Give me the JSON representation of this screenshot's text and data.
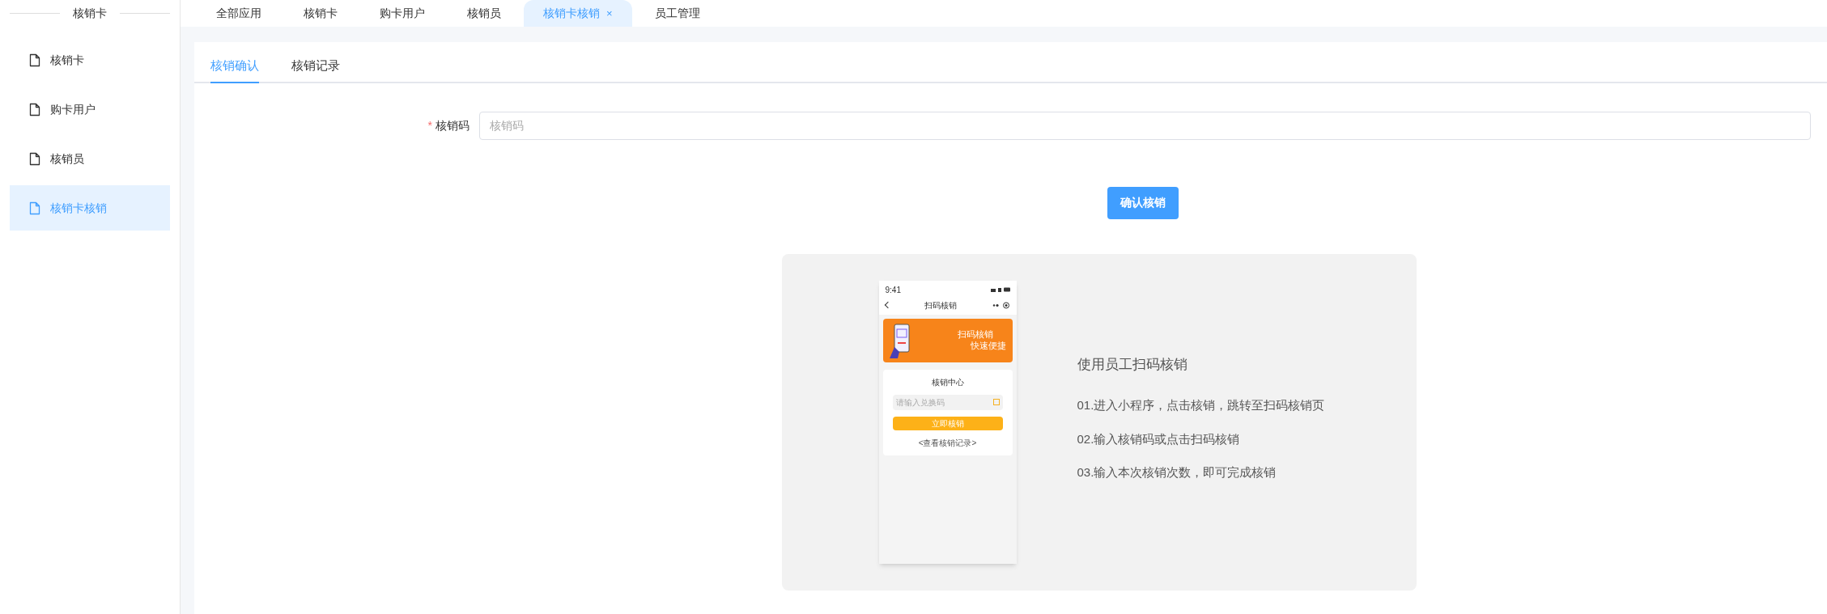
{
  "sidebar": {
    "title": "核销卡",
    "items": [
      {
        "label": "核销卡",
        "selected": false
      },
      {
        "label": "购卡用户",
        "selected": false
      },
      {
        "label": "核销员",
        "selected": false
      },
      {
        "label": "核销卡核销",
        "selected": true
      }
    ]
  },
  "top_tabs": [
    {
      "label": "全部应用",
      "selected": false
    },
    {
      "label": "核销卡",
      "selected": false
    },
    {
      "label": "购卡用户",
      "selected": false
    },
    {
      "label": "核销员",
      "selected": false
    },
    {
      "label": "核销卡核销",
      "selected": true,
      "close_mark": "×"
    },
    {
      "label": "员工管理",
      "selected": false
    }
  ],
  "content_tabs": [
    {
      "label": "核销确认",
      "selected": true
    },
    {
      "label": "核销记录",
      "selected": false
    }
  ],
  "form": {
    "label": "核销码",
    "required_mark": "*",
    "placeholder": "核销码",
    "submit": "确认核销"
  },
  "guide": {
    "phone": {
      "time": "9:41",
      "title": "扫码核销",
      "banner_lines": [
        "扫码核销",
        "快速便捷"
      ],
      "card_title": "核销中心",
      "placeholder": "请输入兑换码",
      "button": "立即核销",
      "link": "<查看核销记录>"
    },
    "title": "使用员工扫码核销",
    "steps": [
      "01.进入小程序，点击核销，跳转至扫码核销页",
      "02.输入核销码或点击扫码核销",
      "03.输入本次核销次数，即可完成核销"
    ]
  }
}
